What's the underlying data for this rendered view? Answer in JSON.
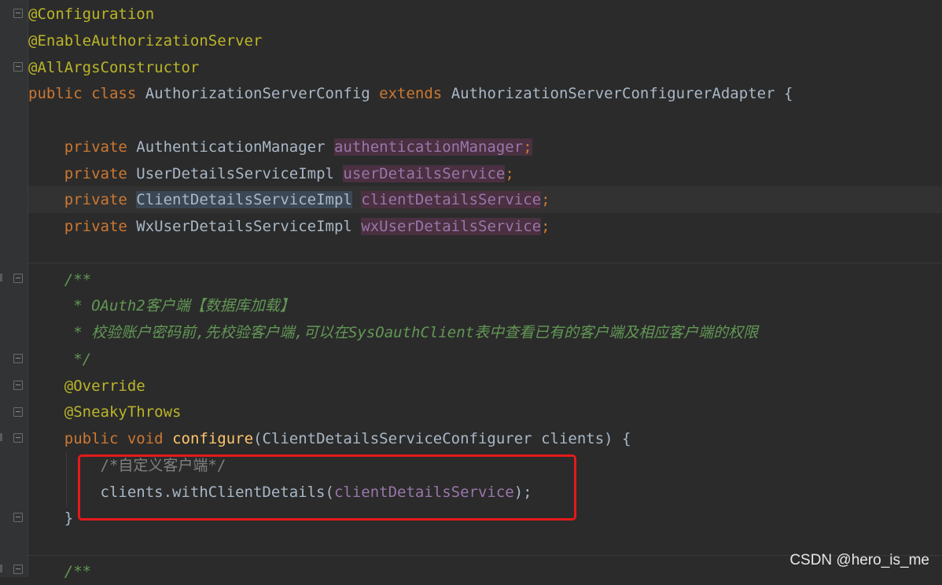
{
  "code": {
    "l1": {
      "annotation": "@Configuration"
    },
    "l2": {
      "annotation": "@EnableAuthorizationServer"
    },
    "l3": {
      "annotation": "@AllArgsConstructor"
    },
    "l4": {
      "kw1": "public class",
      "name": "AuthorizationServerConfig",
      "kw2": "extends",
      "parent": "AuthorizationServerConfigurerAdapter",
      "brace": "{"
    },
    "fields": [
      {
        "modifier": "private",
        "type": "AuthenticationManager",
        "name": "authenticationManager"
      },
      {
        "modifier": "private",
        "type": "UserDetailsServiceImpl",
        "name": "userDetailsService"
      },
      {
        "modifier": "private",
        "type": "ClientDetailsServiceImpl",
        "name": "clientDetailsService"
      },
      {
        "modifier": "private",
        "type": "WxUserDetailsServiceImpl",
        "name": "wxUserDetailsService"
      }
    ],
    "semicolon": ";",
    "javadoc": {
      "open": "/**",
      "line1": " * OAuth2客户端【数据库加载】",
      "line2": " * 校验账户密码前,先校验客户端,可以在SysOauthClient表中查看已有的客户端及相应客户端的权限",
      "close": " */"
    },
    "override": "@Override",
    "sneaky": "@SneakyThrows",
    "method": {
      "kw": "public void",
      "name": "configure",
      "params": "(ClientDetailsServiceConfigurer clients) {"
    },
    "body_comment": "/*自定义客户端*/",
    "call_prefix": "clients.withClientDetails(",
    "call_arg": "clientDetailsService",
    "call_suffix": ");",
    "close_brace": "}",
    "next_javadoc": "/**"
  },
  "watermark": "CSDN @hero_is_me",
  "colors": {
    "background": "#2b2b2b",
    "keyword": "#cc7832",
    "annotation": "#bbb529",
    "field": "#9876aa",
    "doc_comment": "#629755",
    "highlight_box": "#e5191b"
  }
}
